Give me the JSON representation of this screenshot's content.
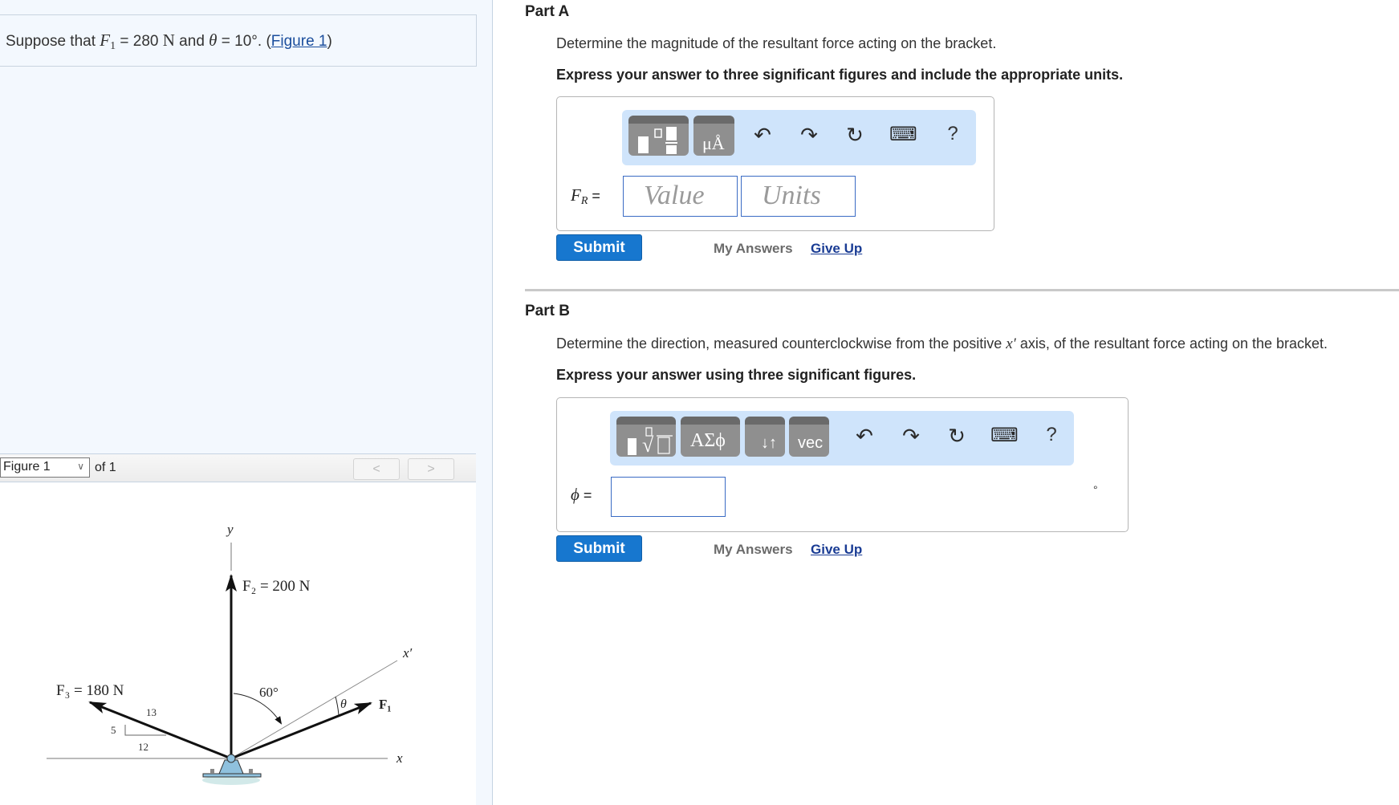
{
  "problem": {
    "prefix": "Suppose that ",
    "f1_symbol": "F",
    "f1_sub": "1",
    "f1_value": " = 280 ",
    "f1_unit": "N",
    "mid": " and ",
    "theta_symbol": "θ",
    "theta_value": " = 10°. (",
    "figure_link": "Figure 1",
    "suffix": ")"
  },
  "figure_panel": {
    "selected": "Figure 1",
    "of_label": "of 1",
    "prev_icon": "chevron-left-icon",
    "next_icon": "chevron-right-icon",
    "prev_glyph": "<",
    "next_glyph": ">",
    "diagram": {
      "y_label": "y",
      "x_label": "x",
      "xprime_label": "x′",
      "f2_label": "F₂ = 200 N",
      "f3_label": "F₃ = 180 N",
      "f1_label": "F₁",
      "angle_60": "60°",
      "theta": "θ",
      "slope_hyp": "13",
      "slope_rise": "5",
      "slope_run": "12"
    }
  },
  "part_a": {
    "title": "Part A",
    "question": "Determine the magnitude of the resultant force acting on the bracket.",
    "instruction": "Express your answer to three significant figures and include the appropriate units.",
    "toolbar": {
      "templates_icon": "templates-icon",
      "units_icon": "units-icon",
      "units_glyph": "μÅ",
      "undo_glyph": "↶",
      "redo_glyph": "↷",
      "reset_glyph": "↻",
      "keyboard_glyph": "⌨",
      "help_glyph": "?"
    },
    "label_main": "F",
    "label_sub": "R",
    "label_eq": " =",
    "value_placeholder": "Value",
    "units_placeholder": "Units",
    "submit": "Submit",
    "my_answers": "My Answers",
    "give_up": "Give Up"
  },
  "part_b": {
    "title": "Part B",
    "question_prefix": "Determine the direction, measured counterclockwise from the positive ",
    "question_var": "x′",
    "question_suffix": " axis, of the resultant force acting on the bracket.",
    "instruction": "Express your answer using three significant figures.",
    "toolbar": {
      "greek_glyph": "ΑΣϕ",
      "arrows_glyph": "↓↑",
      "vec_label": "vec",
      "undo_glyph": "↶",
      "redo_glyph": "↷",
      "reset_glyph": "↻",
      "keyboard_glyph": "⌨",
      "help_glyph": "?"
    },
    "label_main": "ϕ",
    "label_eq": " =",
    "value": "",
    "unit_suffix": "°",
    "submit": "Submit",
    "my_answers": "My Answers",
    "give_up": "Give Up"
  },
  "colors": {
    "left_panel_bg": "#f3f8fe",
    "toolbar_bg": "#cfe4fb",
    "submit_bg": "#1777cf",
    "link": "#1a3c94",
    "input_border": "#3a6bc4"
  }
}
